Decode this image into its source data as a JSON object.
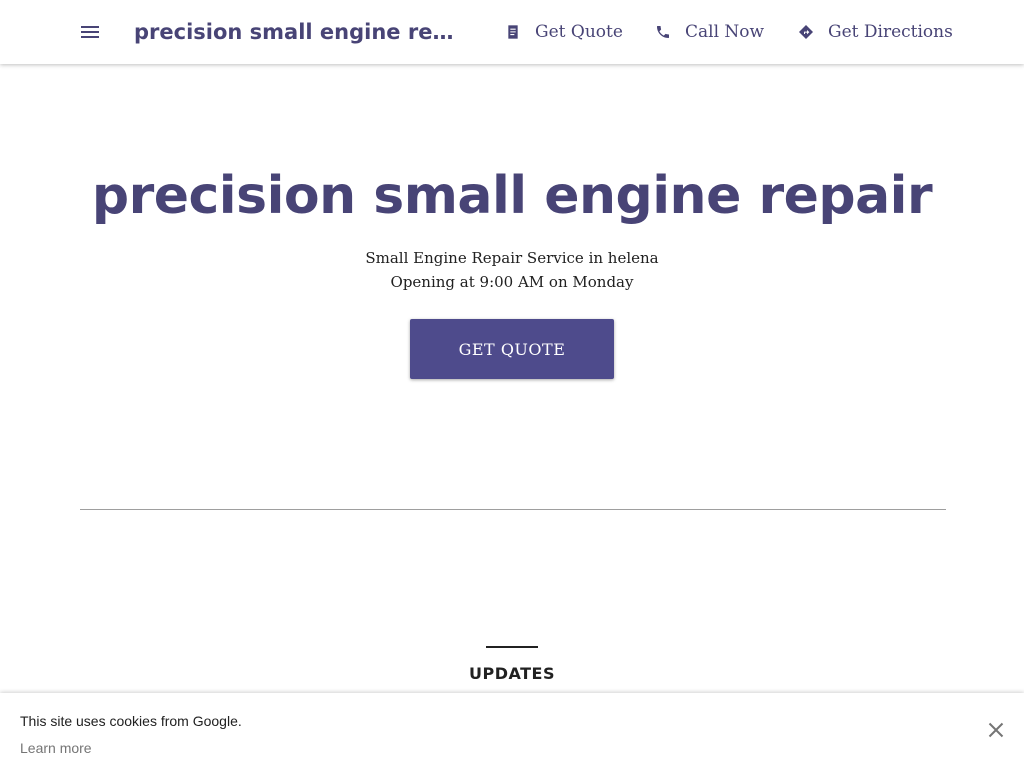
{
  "header": {
    "brand": "precision small engine rep...",
    "menu_icon": "hamburger-menu-icon",
    "actions": [
      {
        "label": "Get Quote",
        "icon": "quote-document-icon"
      },
      {
        "label": "Call Now",
        "icon": "phone-icon"
      },
      {
        "label": "Get Directions",
        "icon": "directions-icon"
      }
    ]
  },
  "hero": {
    "title": "precision small engine repair",
    "subtitle": "Small Engine Repair Service in helena",
    "hours": "Opening at 9:00 AM on Monday",
    "cta_label": "GET QUOTE"
  },
  "updates": {
    "heading": "UPDATES"
  },
  "cookie_banner": {
    "message": "This site uses cookies from Google.",
    "learn_more": "Learn more",
    "close_icon": "close-icon"
  },
  "colors": {
    "brand": "#484476",
    "button": "#4e4b8c",
    "text": "#212121",
    "muted": "#757575"
  }
}
